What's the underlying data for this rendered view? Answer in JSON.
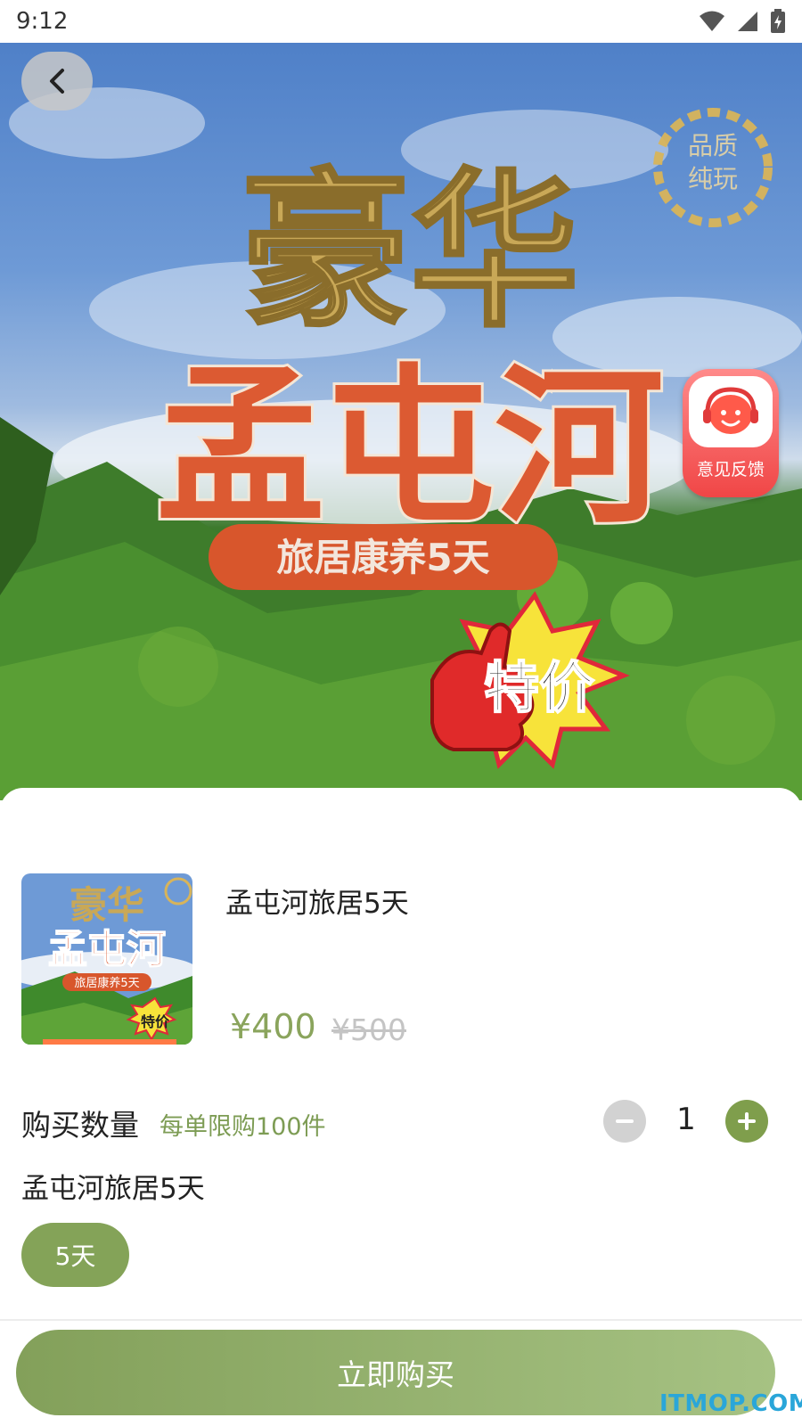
{
  "status_bar": {
    "time": "9:12",
    "icons": [
      "wifi-icon",
      "signal-icon",
      "battery-charging-icon"
    ]
  },
  "hero": {
    "headline_top": "豪华",
    "headline_main": "孟屯河",
    "ribbon": "旅居康养5天",
    "badge": [
      "品质",
      "纯玩"
    ],
    "deal_tag": "特价"
  },
  "feedback": {
    "label": "意见反馈"
  },
  "product": {
    "title": "孟屯河旅居5天",
    "price": "¥400",
    "original_price": "¥500",
    "thumb_lines": [
      "豪华",
      "孟屯河",
      "旅居康养5天",
      "特价"
    ]
  },
  "quantity": {
    "label": "购买数量",
    "limit": "每单限购100件",
    "value": "1"
  },
  "variant": {
    "title": "孟屯河旅居5天",
    "options": [
      "5天"
    ],
    "selected": "5天"
  },
  "actions": {
    "buy_now": "立即购买"
  },
  "watermark": "ITMOP.COM",
  "colors": {
    "accent": "#84a358",
    "price": "#8aa45c",
    "feedback": "#f04646"
  }
}
